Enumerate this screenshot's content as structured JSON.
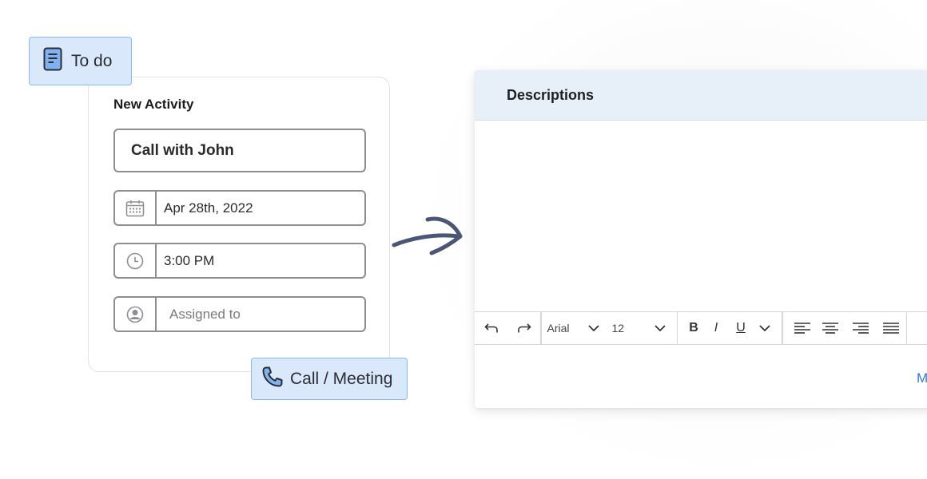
{
  "tags": {
    "todo": {
      "label": "To do",
      "icon": "note-icon"
    },
    "call": {
      "label": "Call / Meeting",
      "icon": "phone-icon"
    }
  },
  "activity": {
    "title": "New Activity",
    "subject": "Call with John",
    "date": "Apr 28th, 2022",
    "time": "3:00 PM",
    "assigned_placeholder": "Assigned to",
    "icons": [
      "calendar-icon",
      "clock-icon",
      "user-icon"
    ]
  },
  "editor": {
    "header": "Descriptions",
    "toolbar": {
      "font": "Arial",
      "size": "12",
      "bold": "B",
      "italic": "I",
      "underline": "U"
    },
    "footer_link": "M"
  },
  "colors": {
    "tag_bg": "#d9e9fb",
    "tag_border": "#86baf2",
    "header_bg": "#e7eff9",
    "arrow": "#4b5676",
    "link": "#2a7ad6"
  }
}
